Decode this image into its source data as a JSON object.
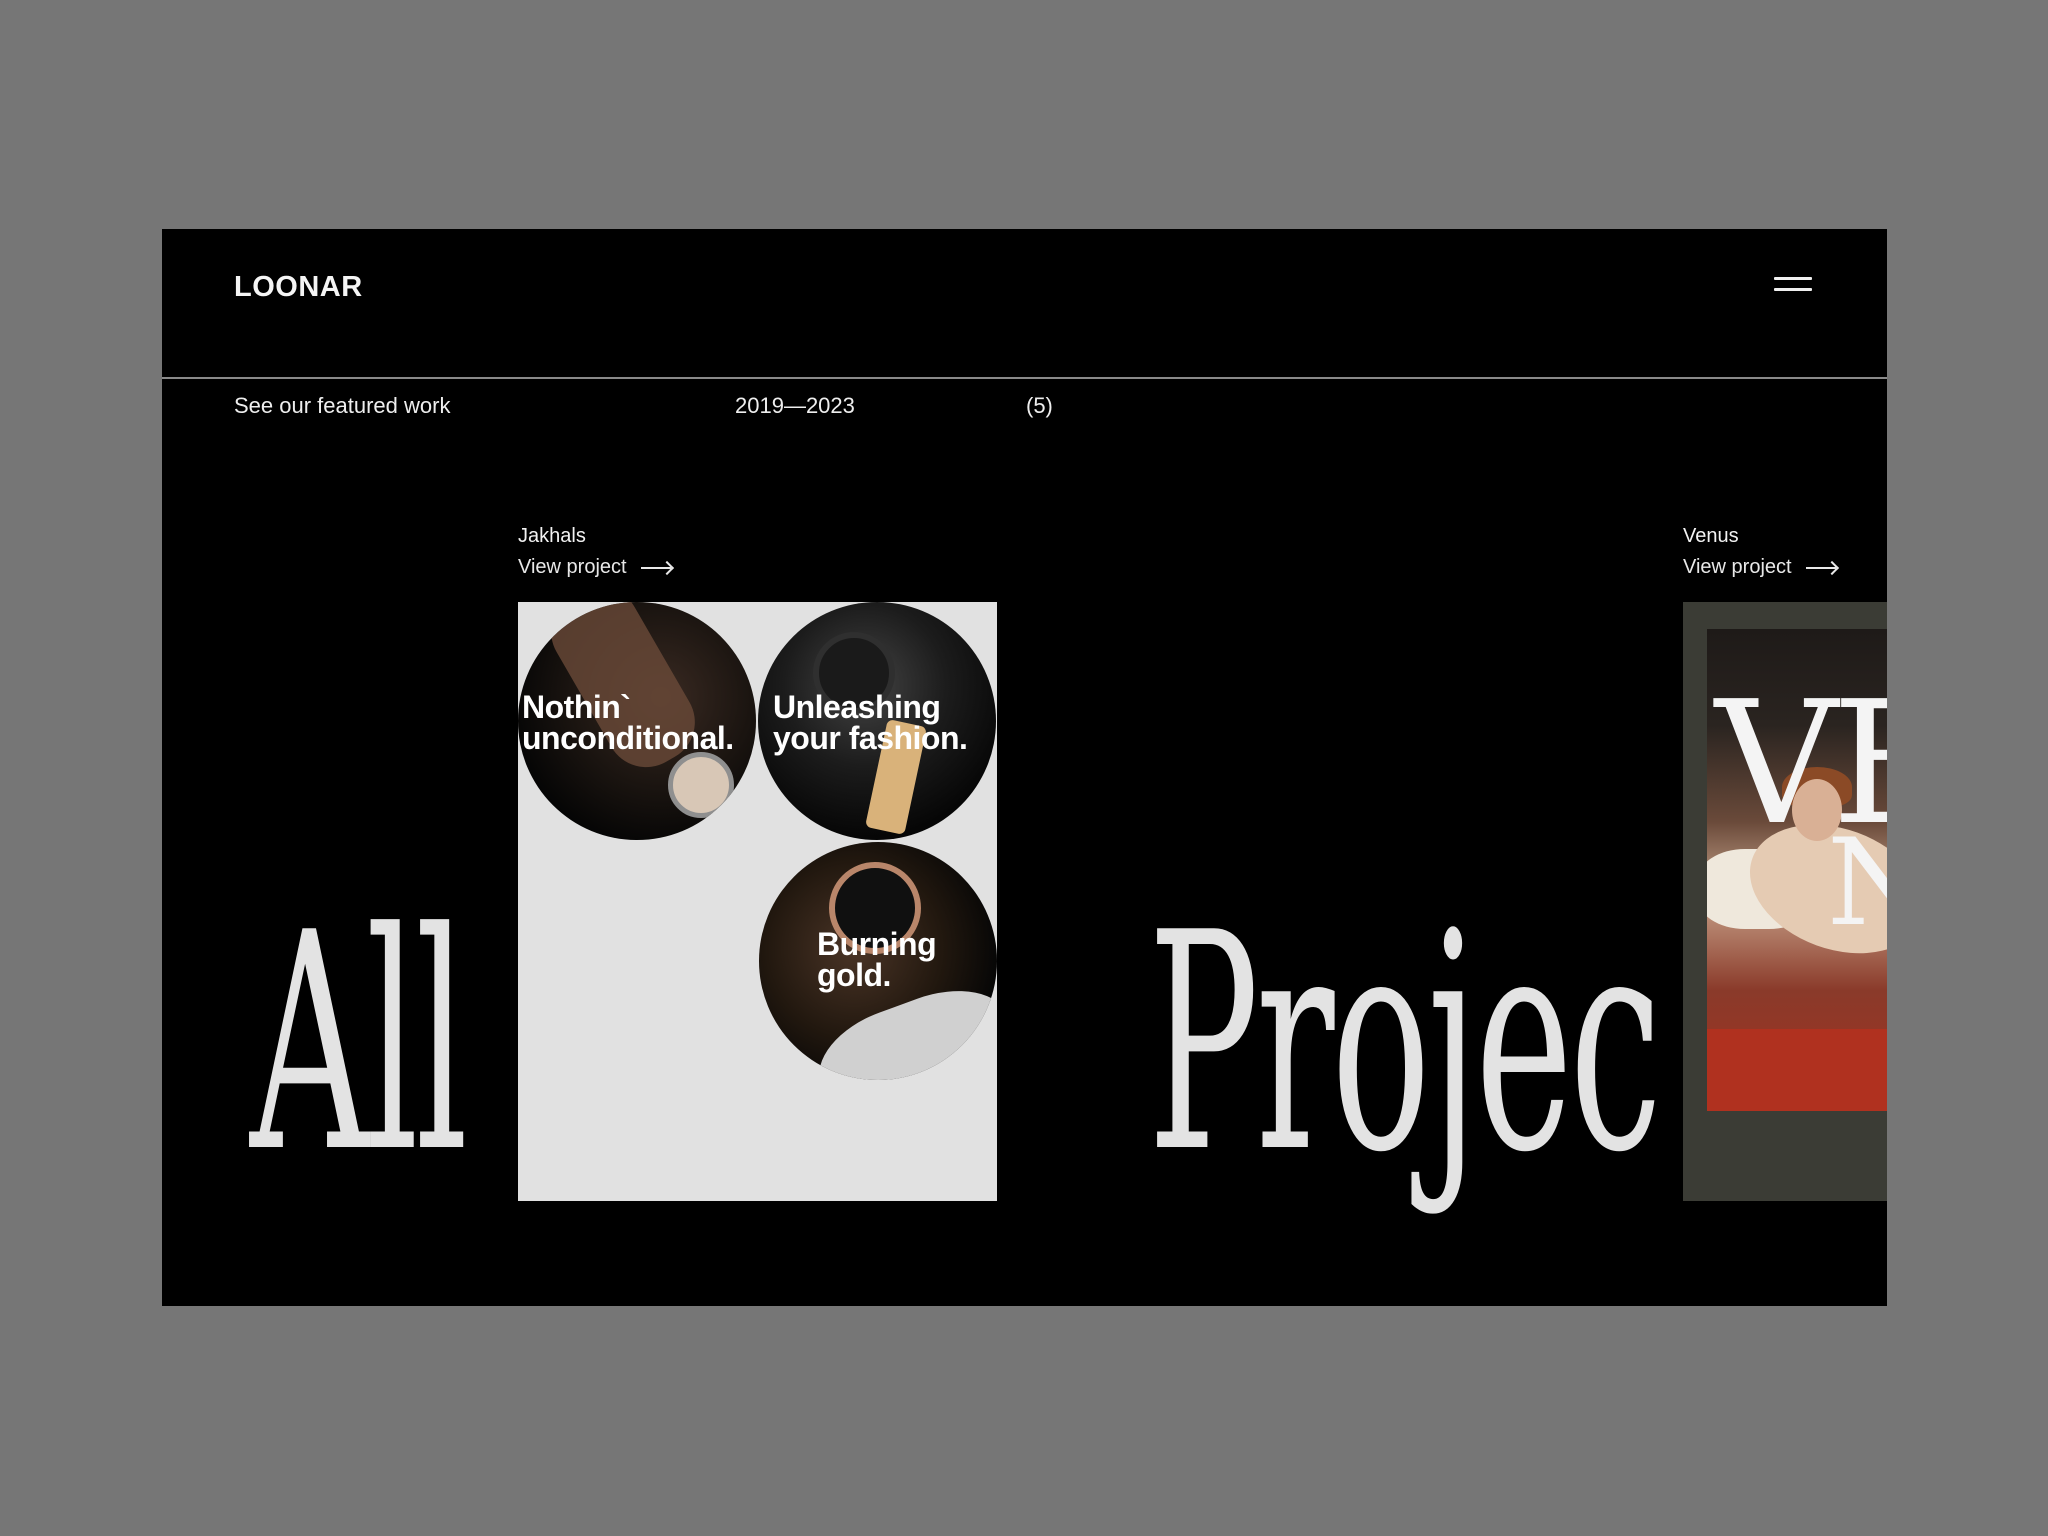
{
  "header": {
    "logo": "LOONAR",
    "menu_icon": "hamburger-menu-icon"
  },
  "intro": {
    "featured": "See our featured work",
    "years": "2019—2023",
    "count": "(5)"
  },
  "headline": {
    "word1": "All",
    "word2": "Projec"
  },
  "projects": [
    {
      "title": "Jakhals",
      "link_label": "View project",
      "image_texts": [
        "Nothin`\nunconditional.",
        "Unleashing\nyour fashion.",
        "Burning\ngold."
      ]
    },
    {
      "title": "Venus",
      "link_label": "View project",
      "image_text_big": "VE",
      "image_text_small": "N"
    }
  ],
  "colors": {
    "page_bg": "#767676",
    "frame_bg": "#000000",
    "headline": "#e3e3e3",
    "jakhals_card": "#e1e1e1",
    "venus_card": "#3b3c35"
  }
}
